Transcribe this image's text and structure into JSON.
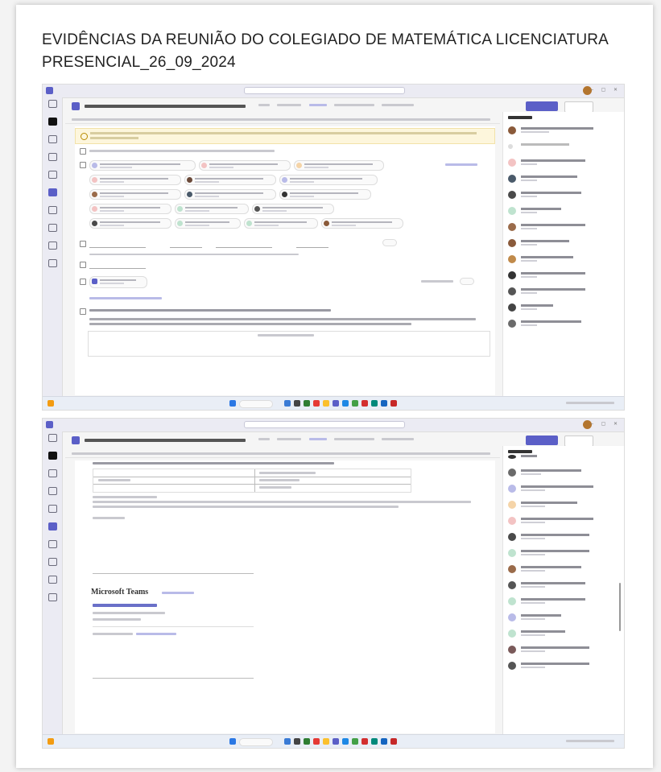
{
  "document": {
    "title": "EVIDÊNCIAS DA REUNIÃO DO COLEGIADO DE MATEMÁTICA LICENCIATURA PRESENCIAL_26_09_2024"
  },
  "screenshot_2": {
    "brand": "Microsoft Teams"
  },
  "colors": {
    "teams_accent": "#5b5fc7",
    "banner_bg": "#fdf6dc"
  },
  "icons": [
    "teams-logo-icon",
    "calendar-icon",
    "chat-icon",
    "search-icon",
    "windows-start-icon",
    "avatar-icon"
  ]
}
